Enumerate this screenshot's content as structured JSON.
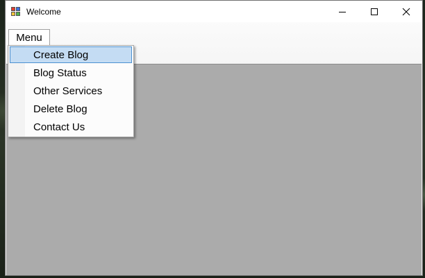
{
  "window": {
    "title": "Welcome",
    "app_icon": "winforms-app-icon",
    "controls": {
      "minimize_icon": "minimize-icon",
      "maximize_icon": "maximize-icon",
      "close_icon": "close-icon"
    }
  },
  "menubar": {
    "root_label": "Menu"
  },
  "dropdown": {
    "items": [
      {
        "label": "Create Blog",
        "selected": true
      },
      {
        "label": "Blog Status",
        "selected": false
      },
      {
        "label": "Other Services",
        "selected": false
      },
      {
        "label": "Delete Blog",
        "selected": false
      },
      {
        "label": "Contact Us",
        "selected": false
      }
    ]
  },
  "colors": {
    "selection_fill": "#c4dcf3",
    "selection_border": "#4b90d0",
    "client_area": "#ababab"
  }
}
